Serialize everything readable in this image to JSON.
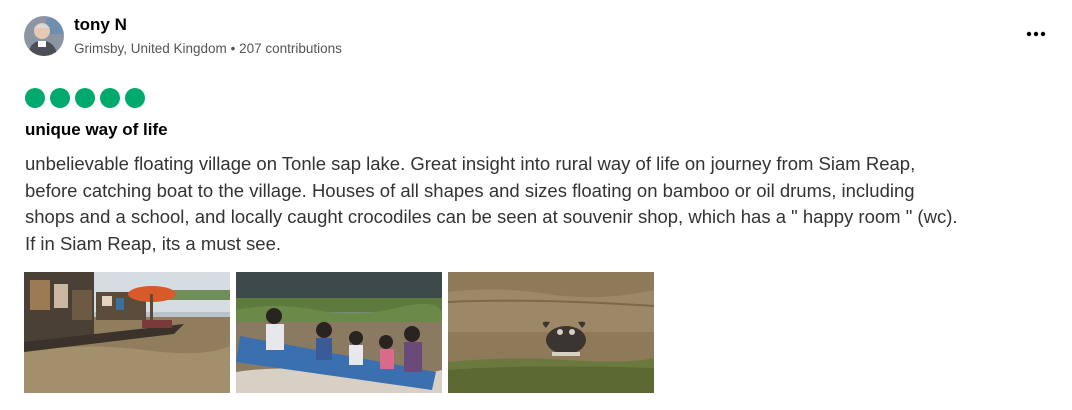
{
  "review": {
    "author": {
      "name": "tony N",
      "location": "Grimsby, United Kingdom",
      "separator": "•",
      "contributions": "207 contributions"
    },
    "more_icon": "more-horizontal-icon",
    "rating": {
      "value": 5,
      "max": 5,
      "color": "#00aa6c"
    },
    "title": "unique way of life",
    "body_lines": [
      "unbelievable floating village on Tonle sap lake. Great insight into rural way of life on journey from Siam Reap,",
      "before catching boat to the village. Houses of all shapes and sizes floating on bamboo or oil drums, including",
      "shops and a school, and locally caught crocodiles can be seen at souvenir shop, which has a \" happy room \" (wc).",
      "If in Siam Reap, its a must see."
    ],
    "photos": [
      {
        "subject": "floating-market-boats"
      },
      {
        "subject": "children-in-boat"
      },
      {
        "subject": "water-buffalo"
      }
    ]
  }
}
